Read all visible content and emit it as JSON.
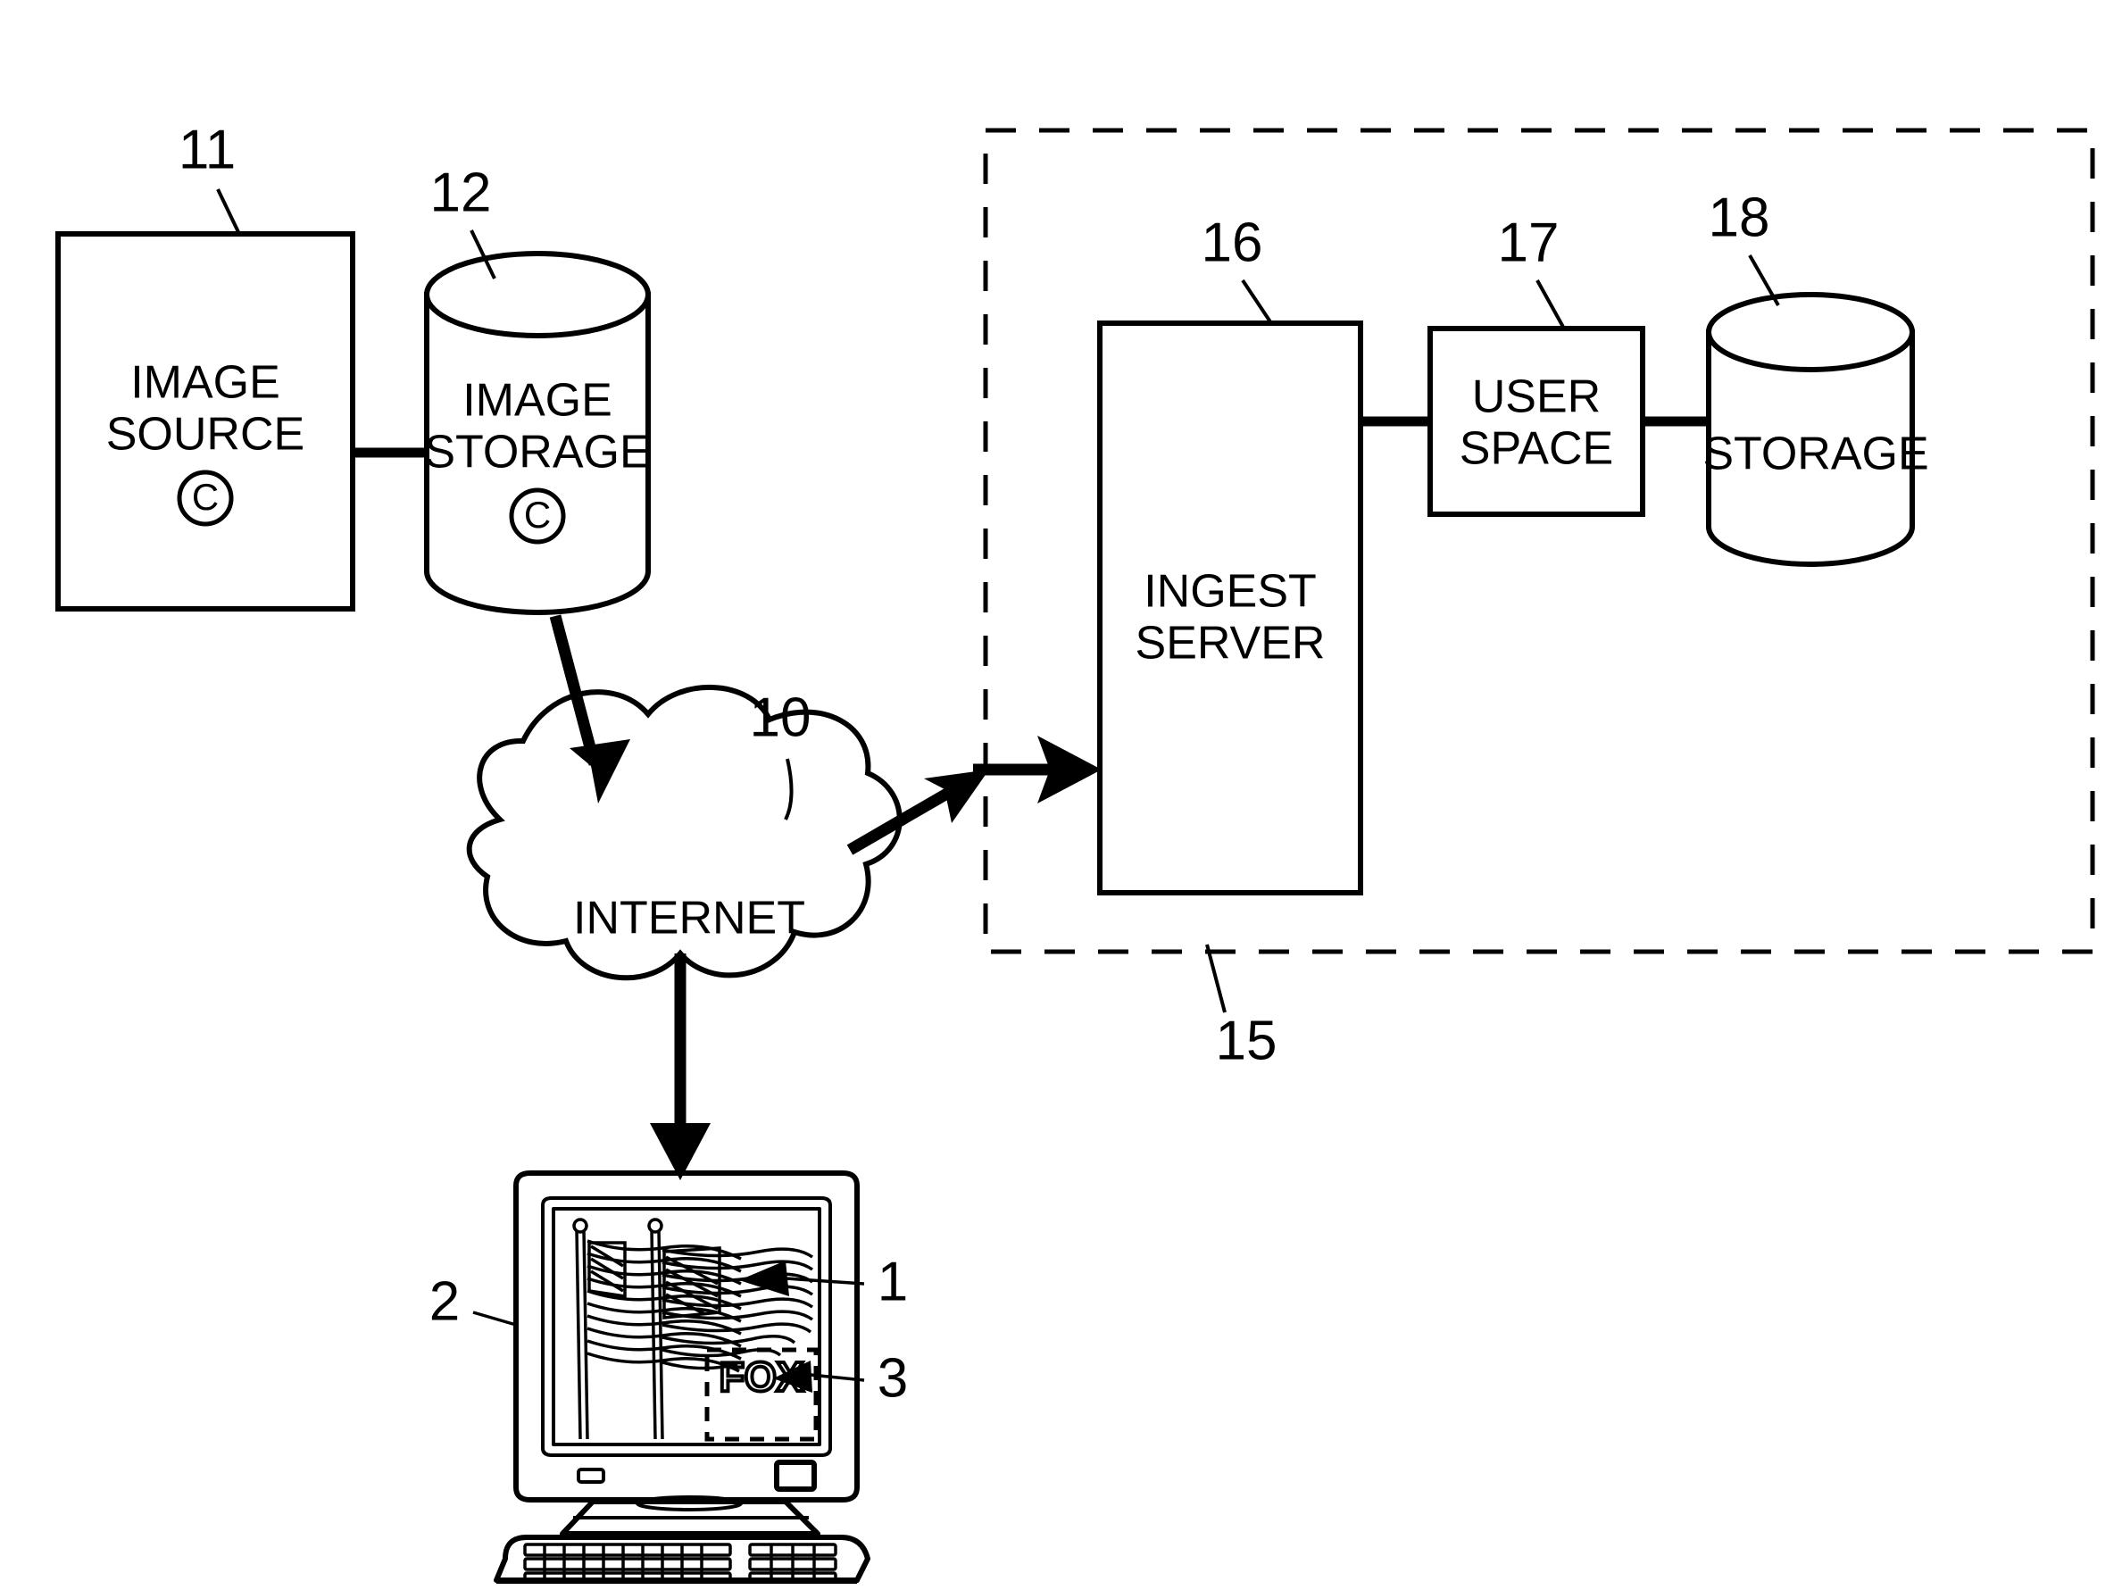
{
  "figure": {
    "type": "patent-diagram",
    "background": "#ffffff",
    "ink": "#000000"
  },
  "nodes": {
    "image_source": {
      "label_line1": "IMAGE",
      "label_line2": "SOURCE",
      "copyright_mark": "C",
      "ref": "11",
      "shape": "rectangle"
    },
    "image_storage": {
      "label_line1": "IMAGE",
      "label_line2": "STORAGE",
      "copyright_mark": "C",
      "ref": "12",
      "shape": "cylinder"
    },
    "internet": {
      "label": "INTERNET",
      "ref": "10",
      "shape": "cloud"
    },
    "ingest_server": {
      "label_line1": "INGEST",
      "label_line2": "SERVER",
      "ref": "16",
      "shape": "rectangle"
    },
    "user_space": {
      "label_line1": "USER",
      "label_line2": "SPACE",
      "ref": "17",
      "shape": "rectangle"
    },
    "storage": {
      "label": "STORAGE",
      "ref": "18",
      "shape": "cylinder"
    },
    "system_boundary": {
      "ref": "15",
      "shape": "dashed-rectangle"
    },
    "computer": {
      "ref": "2",
      "shape": "desktop-computer"
    },
    "displayed_image": {
      "ref": "1",
      "description": "american-flags"
    },
    "watermark": {
      "ref": "3",
      "label": "FOX"
    }
  },
  "reference_numerals": [
    {
      "id": "n11",
      "value": "11"
    },
    {
      "id": "n12",
      "value": "12"
    },
    {
      "id": "n10",
      "value": "10"
    },
    {
      "id": "n16",
      "value": "16"
    },
    {
      "id": "n17",
      "value": "17"
    },
    {
      "id": "n18",
      "value": "18"
    },
    {
      "id": "n15",
      "value": "15"
    },
    {
      "id": "n1",
      "value": "1"
    },
    {
      "id": "n2",
      "value": "2"
    },
    {
      "id": "n3",
      "value": "3"
    }
  ],
  "connections": [
    {
      "from": "image_source",
      "to": "image_storage",
      "style": "solid-line"
    },
    {
      "from": "image_storage",
      "to": "internet",
      "style": "arrow"
    },
    {
      "from": "internet",
      "to": "ingest_server",
      "style": "double-arrow"
    },
    {
      "from": "internet",
      "to": "computer",
      "style": "arrow"
    },
    {
      "from": "ingest_server",
      "to": "user_space",
      "style": "solid-line"
    },
    {
      "from": "user_space",
      "to": "storage",
      "style": "solid-line"
    }
  ]
}
